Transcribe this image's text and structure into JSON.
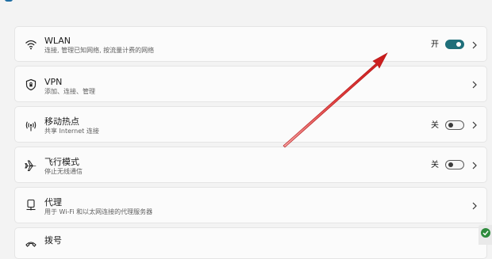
{
  "items": [
    {
      "title": "WLAN",
      "subtitle": "连接, 管理已知网络, 按流量计费的网络",
      "state": "开",
      "toggle": "on",
      "icon": "wifi-icon"
    },
    {
      "title": "VPN",
      "subtitle": "添加、连接、管理",
      "icon": "shield-icon"
    },
    {
      "title": "移动热点",
      "subtitle": "共享 Internet 连接",
      "state": "关",
      "toggle": "off",
      "icon": "hotspot-icon"
    },
    {
      "title": "飞行模式",
      "subtitle": "停止无线通信",
      "state": "关",
      "toggle": "off",
      "icon": "airplane-icon"
    },
    {
      "title": "代理",
      "subtitle": "用于 Wi-Fi 和以太网连接的代理服务器",
      "icon": "proxy-icon"
    },
    {
      "title": "拨号",
      "icon": "dialup-icon"
    }
  ],
  "colors": {
    "toggle_on": "#1f6f7a",
    "annotation_arrow": "#d42020"
  }
}
